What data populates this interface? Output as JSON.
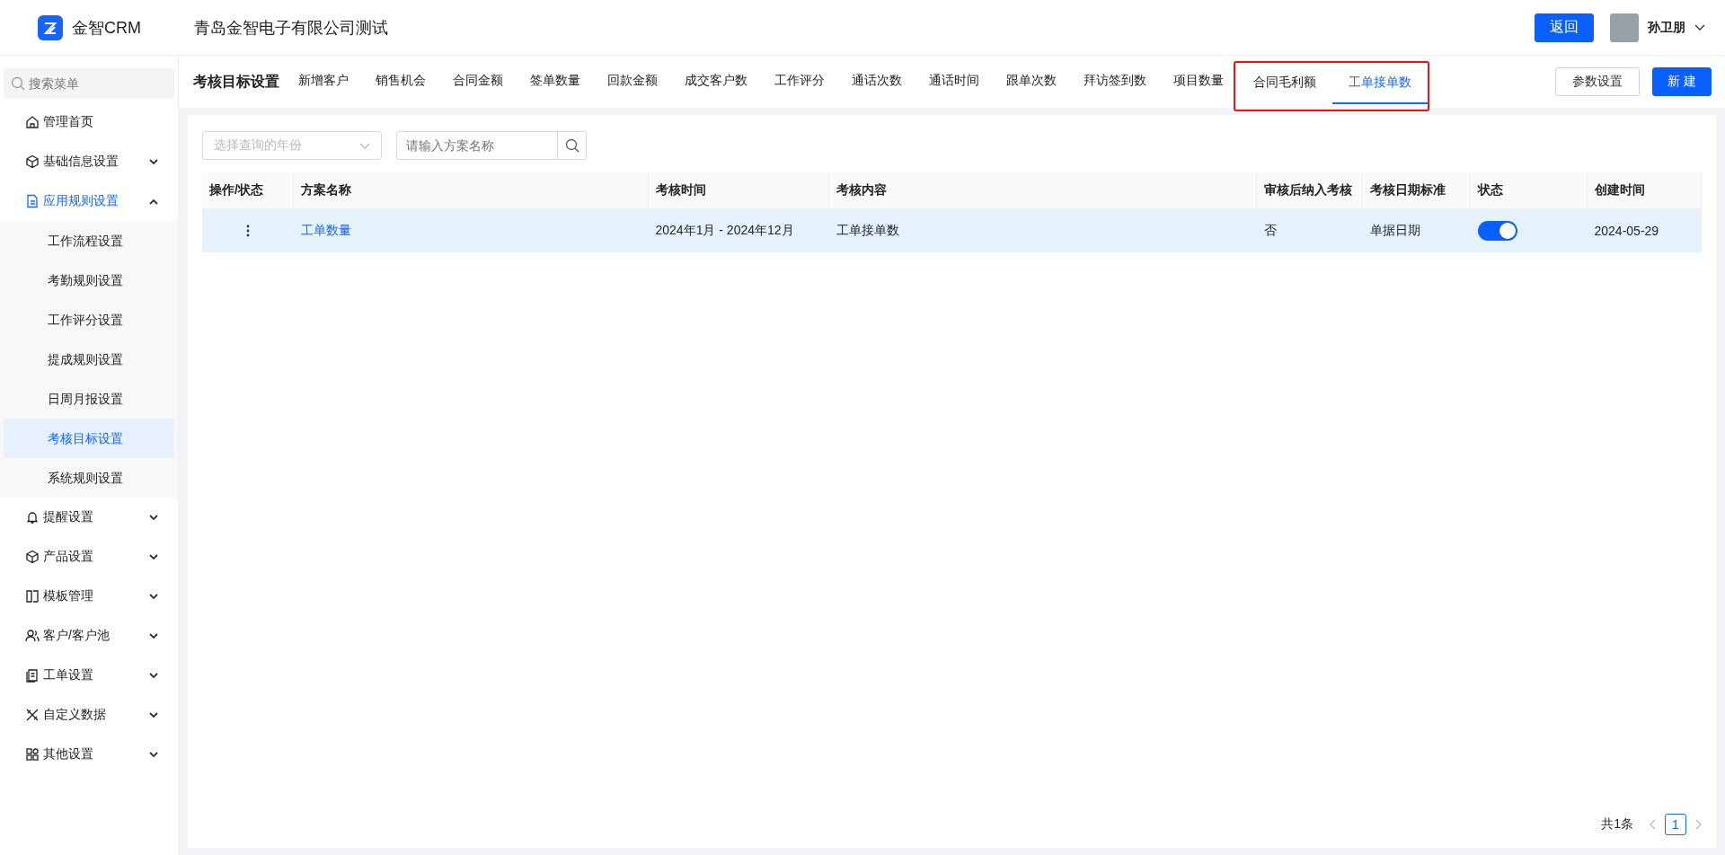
{
  "header": {
    "logo_text": "金智CRM",
    "company": "青岛金智电子有限公司测试",
    "back_button": "返回",
    "user_name": "孙卫朋"
  },
  "sidebar": {
    "search": {
      "placeholder": "搜索菜单"
    },
    "items": [
      {
        "label": "管理首页"
      },
      {
        "label": "基础信息设置",
        "expanded": false
      },
      {
        "label": "应用规则设置",
        "expanded": true,
        "children": [
          {
            "label": "工作流程设置",
            "selected": false
          },
          {
            "label": "考勤规则设置",
            "selected": false
          },
          {
            "label": "工作评分设置",
            "selected": false
          },
          {
            "label": "提成规则设置",
            "selected": false
          },
          {
            "label": "日周月报设置",
            "selected": false
          },
          {
            "label": "考核目标设置",
            "selected": true
          },
          {
            "label": "系统规则设置",
            "selected": false
          }
        ]
      },
      {
        "label": "提醒设置",
        "expanded": false
      },
      {
        "label": "产品设置",
        "expanded": false
      },
      {
        "label": "模板管理",
        "expanded": false
      },
      {
        "label": "客户/客户池",
        "expanded": false
      },
      {
        "label": "工单设置",
        "expanded": false
      },
      {
        "label": "自定义数据",
        "expanded": false
      },
      {
        "label": "其他设置",
        "expanded": false
      }
    ]
  },
  "page_title": "考核目标设置",
  "tabs": [
    {
      "label": "新增客户",
      "selected": false,
      "highlighted": false
    },
    {
      "label": "销售机会",
      "selected": false,
      "highlighted": false
    },
    {
      "label": "合同金额",
      "selected": false,
      "highlighted": false
    },
    {
      "label": "签单数量",
      "selected": false,
      "highlighted": false
    },
    {
      "label": "回款金额",
      "selected": false,
      "highlighted": false
    },
    {
      "label": "成交客户数",
      "selected": false,
      "highlighted": false
    },
    {
      "label": "工作评分",
      "selected": false,
      "highlighted": false
    },
    {
      "label": "通话次数",
      "selected": false,
      "highlighted": false
    },
    {
      "label": "通话时间",
      "selected": false,
      "highlighted": false
    },
    {
      "label": "跟单次数",
      "selected": false,
      "highlighted": false
    },
    {
      "label": "拜访签到数",
      "selected": false,
      "highlighted": false
    },
    {
      "label": "项目数量",
      "selected": false,
      "highlighted": false
    },
    {
      "label": "合同毛利额",
      "selected": false,
      "highlighted": true
    },
    {
      "label": "工单接单数",
      "selected": true,
      "highlighted": true
    }
  ],
  "toolbar_buttons": [
    {
      "label": "参数设置",
      "kind": "secondary"
    },
    {
      "label": "新 建",
      "kind": "primary"
    }
  ],
  "filters": {
    "year_select": {
      "placeholder": "选择查询的年份"
    },
    "name_search": {
      "placeholder": "请输入方案名称"
    }
  },
  "table": {
    "columns": [
      "操作/状态",
      "方案名称",
      "考核时间",
      "考核内容",
      "审核后纳入考核",
      "考核日期标准",
      "状态",
      "创建时间"
    ],
    "rows": [
      {
        "selected": true,
        "name": "工单数量",
        "period": "2024年1月 - 2024年12月",
        "content": "工单接单数",
        "include_after_review": "否",
        "date_standard": "单据日期",
        "status_on": true,
        "created": "2024-05-29"
      }
    ]
  },
  "pagination": {
    "total": "共1条",
    "pages": [
      {
        "label": "1",
        "selected": true
      }
    ]
  }
}
